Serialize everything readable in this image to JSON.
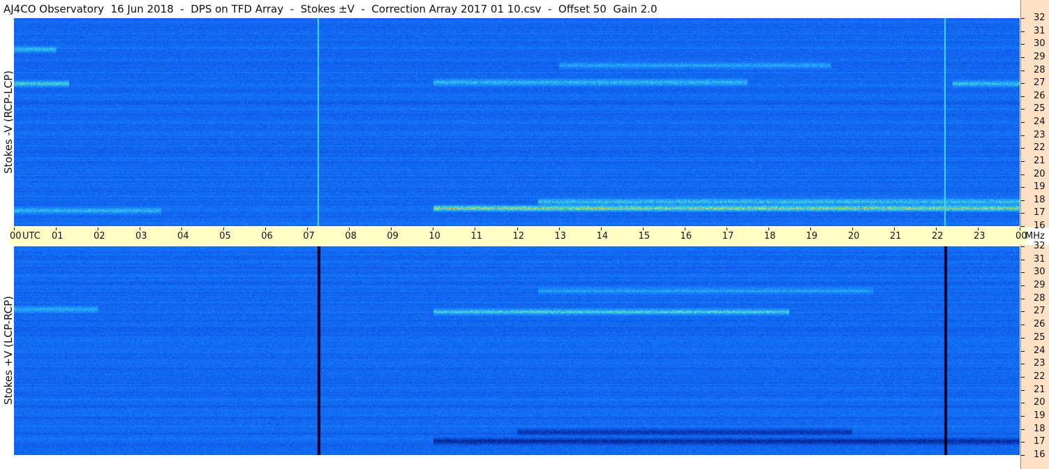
{
  "title": "AJ4CO Observatory  16 Jun 2018  -  DPS on TFD Array  -  Stokes ±V  -  Correction Array 2017 01 10.csv  -  Offset 50  Gain 2.0",
  "colors": {
    "background": "#1060f0",
    "time_axis_band": "#ffffc6",
    "freq_axis_band": "#ffe1c6",
    "emission_hot": "#ffe020",
    "emission_warm": "#40e0d0",
    "gap_line": "#000020"
  },
  "chart_data": [
    {
      "type": "heatmap",
      "panel": "top",
      "ylabel": "Stokes -V (RCP-LCP)",
      "y_unit": "MHz",
      "ylim": [
        16,
        32
      ],
      "y_ticks": [
        "32",
        "31",
        "30",
        "29",
        "28",
        "27",
        "26",
        "25",
        "24",
        "23",
        "22",
        "21",
        "20",
        "19",
        "18",
        "17",
        "16"
      ],
      "x_ticks": [
        "00",
        "UTC",
        "01",
        "02",
        "03",
        "04",
        "05",
        "06",
        "07",
        "08",
        "09",
        "10",
        "11",
        "12",
        "13",
        "14",
        "15",
        "16",
        "17",
        "18",
        "19",
        "20",
        "21",
        "22",
        "23",
        "00"
      ],
      "xlim_utc_hours": [
        0,
        24
      ],
      "cal_marker_hours": [
        7.25,
        22.2
      ],
      "emission_features": [
        {
          "utc_start": 0.0,
          "utc_end": 1.3,
          "freq_mhz": 27.0,
          "intensity": 0.8
        },
        {
          "utc_start": 0.0,
          "utc_end": 1.0,
          "freq_mhz": 29.6,
          "intensity": 0.7
        },
        {
          "utc_start": 0.0,
          "utc_end": 3.5,
          "freq_mhz": 17.2,
          "intensity": 0.6
        },
        {
          "utc_start": 10.0,
          "utc_end": 24.0,
          "freq_mhz": 17.4,
          "intensity": 1.0
        },
        {
          "utc_start": 12.5,
          "utc_end": 24.0,
          "freq_mhz": 17.9,
          "intensity": 0.8
        },
        {
          "utc_start": 10.0,
          "utc_end": 17.5,
          "freq_mhz": 27.1,
          "intensity": 0.7
        },
        {
          "utc_start": 13.0,
          "utc_end": 19.5,
          "freq_mhz": 28.4,
          "intensity": 0.6
        },
        {
          "utc_start": 22.4,
          "utc_end": 24.0,
          "freq_mhz": 27.0,
          "intensity": 0.7
        }
      ]
    },
    {
      "type": "heatmap",
      "panel": "bottom",
      "ylabel": "Stokes +V (LCP-RCP)",
      "y_unit": "MHz",
      "ylim": [
        16,
        32
      ],
      "y_ticks": [
        "32",
        "31",
        "30",
        "29",
        "28",
        "27",
        "26",
        "25",
        "24",
        "23",
        "22",
        "21",
        "20",
        "19",
        "18",
        "17",
        "16"
      ],
      "x_ticks": [
        "00",
        "UTC",
        "01",
        "02",
        "03",
        "04",
        "05",
        "06",
        "07",
        "08",
        "09",
        "10",
        "11",
        "12",
        "13",
        "14",
        "15",
        "16",
        "17",
        "18",
        "19",
        "20",
        "21",
        "22",
        "23",
        "00"
      ],
      "xlim_utc_hours": [
        0,
        24
      ],
      "cal_marker_hours": [
        7.25,
        22.2
      ],
      "emission_features": [
        {
          "utc_start": 0.0,
          "utc_end": 2.0,
          "freq_mhz": 27.2,
          "intensity": 0.6
        },
        {
          "utc_start": 10.0,
          "utc_end": 18.5,
          "freq_mhz": 27.0,
          "intensity": 0.8
        },
        {
          "utc_start": 12.5,
          "utc_end": 20.5,
          "freq_mhz": 28.6,
          "intensity": 0.5
        },
        {
          "utc_start": 10.0,
          "utc_end": 24.0,
          "freq_mhz": 17.1,
          "intensity": -0.8
        },
        {
          "utc_start": 12.0,
          "utc_end": 20.0,
          "freq_mhz": 17.8,
          "intensity": -0.6
        }
      ]
    }
  ]
}
